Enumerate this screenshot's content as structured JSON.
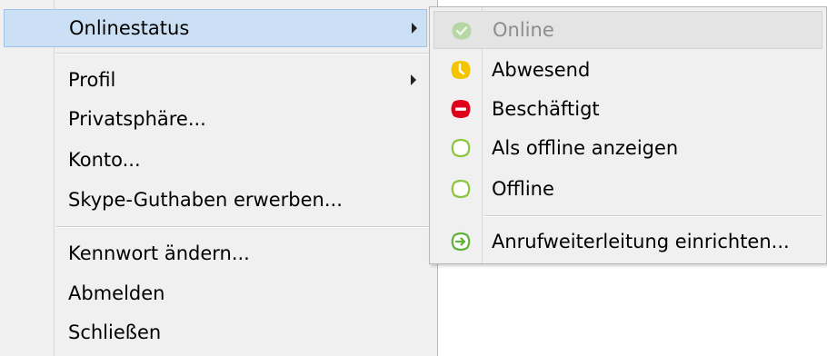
{
  "main_menu": {
    "items": [
      {
        "label": "Onlinestatus",
        "has_submenu": true,
        "highlighted": true
      },
      {
        "label": "Profil",
        "has_submenu": true
      },
      {
        "label": "Privatsphäre..."
      },
      {
        "label": "Konto..."
      },
      {
        "label": "Skype-Guthaben erwerben..."
      },
      {
        "label": "Kennwort ändern..."
      },
      {
        "label": "Abmelden"
      },
      {
        "label": "Schließen"
      }
    ]
  },
  "status_menu": {
    "items": [
      {
        "label": "Online",
        "icon": "status-online-icon",
        "disabled": true,
        "color": "#b7d6a5"
      },
      {
        "label": "Abwesend",
        "icon": "status-away-icon",
        "color": "#f5c400"
      },
      {
        "label": "Beschäftigt",
        "icon": "status-busy-icon",
        "color": "#e0001b"
      },
      {
        "label": "Als offline anzeigen",
        "icon": "status-invisible-icon",
        "color": "#8cc63f"
      },
      {
        "label": "Offline",
        "icon": "status-offline-icon",
        "color": "#8cc63f"
      },
      {
        "label": "Anrufweiterleitung einrichten...",
        "icon": "call-forward-icon",
        "color": "#5fb336"
      }
    ]
  }
}
